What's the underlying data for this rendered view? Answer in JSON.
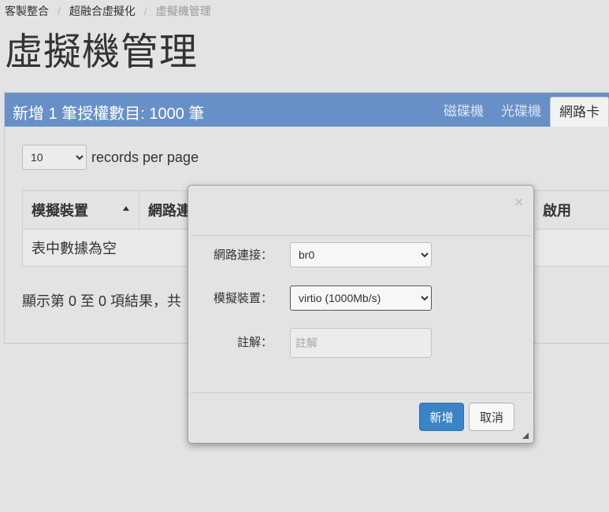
{
  "breadcrumb": {
    "items": [
      "客製整合",
      "超融合虛擬化",
      "虛擬機管理"
    ],
    "separator": "/"
  },
  "page_title": "虛擬機管理",
  "panel": {
    "title": "新增 1 筆授權數目: 1000 筆",
    "tabs": [
      {
        "label": "磁碟機",
        "active": false
      },
      {
        "label": "光碟機",
        "active": false
      },
      {
        "label": "網路卡",
        "active": true
      }
    ],
    "header_color": "#6790c8"
  },
  "records": {
    "selected": "10",
    "label": "records per page"
  },
  "table": {
    "columns": [
      "模擬裝置",
      "網路連",
      "啟用"
    ],
    "empty_text": "表中數據為空"
  },
  "info_text": "顯示第 0 至 0 項結果，共",
  "modal": {
    "close_icon": "×",
    "fields": {
      "network": {
        "label": "網路連接：",
        "value": "br0"
      },
      "device": {
        "label": "模擬裝置：",
        "value": "virtio (1000Mb/s)"
      },
      "note": {
        "label": "註解：",
        "placeholder": "註解",
        "value": ""
      }
    },
    "submit_label": "新增",
    "cancel_label": "取消",
    "primary_color": "#3a83c7"
  }
}
